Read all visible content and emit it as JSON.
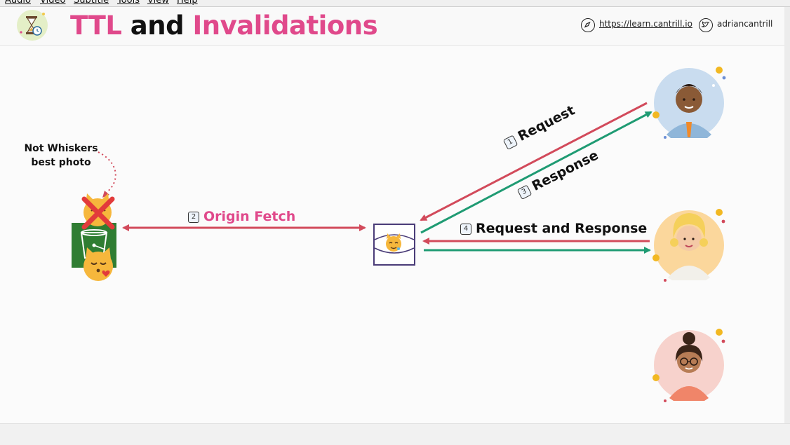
{
  "menu": [
    "Audio",
    "Video",
    "Subtitle",
    "Tools",
    "View",
    "Help"
  ],
  "header": {
    "title_part1": "TTL",
    "title_part2": "and",
    "title_part3": "Invalidations",
    "link_url": "https://learn.cantrill.io",
    "twitter_handle": "adriancantrill"
  },
  "colors": {
    "pink": "#e0498b",
    "request_arrow": "#d24a5b",
    "response_arrow": "#1f9b73",
    "edge_box": "#4a3c78",
    "s3_green": "#2f7d32"
  },
  "icons": {
    "logo": "hourglass-clock-icon",
    "link": "compass-icon",
    "twitter": "twitter-bird-icon",
    "origin": "s3-bucket-icon",
    "edge": "cloudfront-edge-icon",
    "x_mark": "red-x-icon"
  },
  "diagram": {
    "note": [
      "Not Whiskers",
      "best photo"
    ],
    "origin_fetch": {
      "num": "2",
      "text": "Origin Fetch"
    },
    "request": {
      "num": "1",
      "text": "Request"
    },
    "response": {
      "num": "3",
      "text": "Response"
    },
    "req_resp": {
      "num": "4",
      "text": "Request and Response"
    }
  }
}
